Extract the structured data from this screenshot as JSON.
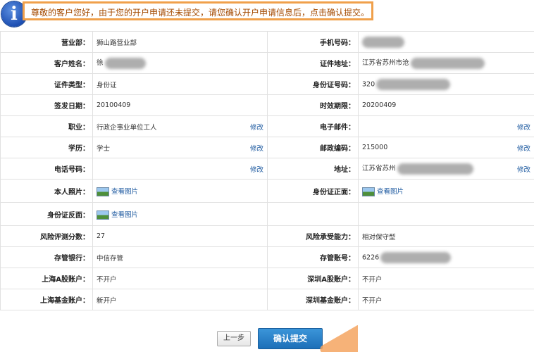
{
  "notice": {
    "icon": "info-icon",
    "text": "尊敬的客户您好，由于您的开户申请还未提交，请您确认开户申请信息后，点击确认提交。"
  },
  "edit_label": "修改",
  "view_pic_label": "查看图片",
  "rows": [
    {
      "l1": "营业部：",
      "v1": "狮山路营业部",
      "e1": false,
      "l2": "手机号码：",
      "v2": "",
      "e2": false
    },
    {
      "l1": "客户姓名：",
      "v1": "徐",
      "e1": false,
      "l2": "证件地址：",
      "v2": "江苏省苏州市沧",
      "e2": false
    },
    {
      "l1": "证件类型：",
      "v1": "身份证",
      "e1": false,
      "l2": "身份证号码：",
      "v2": "320",
      "e2": false
    },
    {
      "l1": "签发日期：",
      "v1": "20100409",
      "e1": false,
      "l2": "时效期限：",
      "v2": "20200409",
      "e2": false
    },
    {
      "l1": "职业：",
      "v1": "行政企事业单位工人",
      "e1": true,
      "l2": "电子邮件：",
      "v2": "",
      "e2": true
    },
    {
      "l1": "学历：",
      "v1": "学士",
      "e1": true,
      "l2": "邮政编码：",
      "v2": "215000",
      "e2": true
    },
    {
      "l1": "电话号码：",
      "v1": "",
      "e1": true,
      "l2": "地址：",
      "v2": "江苏省苏州",
      "e2": true
    },
    {
      "l1": "本人照片：",
      "v1": "",
      "e1": false,
      "l2": "身份证正面：",
      "v2": "",
      "e2": false
    },
    {
      "l1": "身份证反面：",
      "v1": "",
      "e1": false,
      "l2": "",
      "v2": "",
      "e2": false
    },
    {
      "l1": "风险评测分数：",
      "v1": "27",
      "e1": false,
      "l2": "风险承受能力：",
      "v2": "相对保守型",
      "e2": false
    },
    {
      "l1": "存管银行：",
      "v1": "中信存管",
      "e1": false,
      "l2": "存管账号：",
      "v2": "6226",
      "e2": false
    },
    {
      "l1": "上海A股账户：",
      "v1": "不开户",
      "e1": false,
      "l2": "深圳A股账户：",
      "v2": "不开户",
      "e2": false
    },
    {
      "l1": "上海基金账户：",
      "v1": "新开户",
      "e1": false,
      "l2": "深圳基金账户：",
      "v2": "不开户",
      "e2": false
    }
  ],
  "buttons": {
    "prev": "上一步",
    "confirm": "确认提交"
  }
}
